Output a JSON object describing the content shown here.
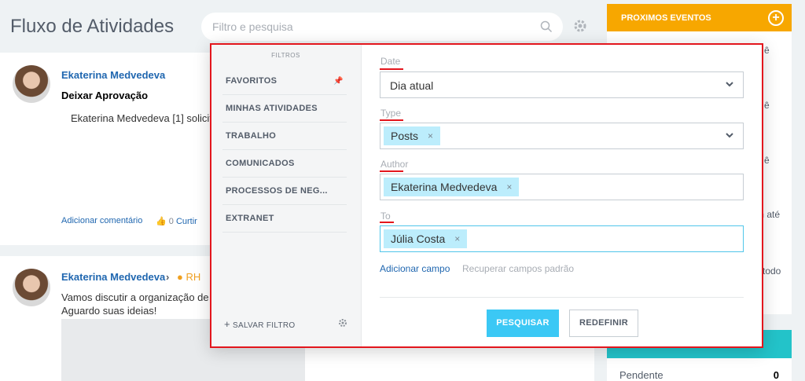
{
  "header": {
    "title": "Fluxo de Atividades",
    "search_placeholder": "Filtro e pesquisa"
  },
  "feed": {
    "post1": {
      "author": "Ekaterina Medvedeva",
      "title": "Deixar Aprovação",
      "text": "Ekaterina Medvedeva [1] solicit",
      "comment_link": "Adicionar comentário",
      "like_count": "0",
      "like_label": "Curtir"
    },
    "post2": {
      "author": "Ekaterina Medvedeva",
      "chevron": "›",
      "group": "RH",
      "text_line1": "Vamos discutir a organização de r",
      "text_line2": "Aguardo suas ideias!"
    }
  },
  "right_panel": {
    "events_title": "PROXIMOS EVENTOS",
    "fragments": [
      "ê",
      "ê",
      "ê",
      "m até",
      "todo"
    ],
    "pending_label": "Pendente",
    "pending_count": "0"
  },
  "filter_popup": {
    "filters_heading": "FILTROS",
    "presets": [
      {
        "label": "FAVORITOS"
      },
      {
        "label": "MINHAS ATIVIDADES"
      },
      {
        "label": "TRABALHO"
      },
      {
        "label": "COMUNICADOS"
      },
      {
        "label": "PROCESSOS DE NEG..."
      },
      {
        "label": "EXTRANET"
      }
    ],
    "save_filter_label": "SALVAR FILTRO",
    "fields": {
      "date": {
        "label": "Date",
        "value": "Dia atual"
      },
      "type": {
        "label": "Type",
        "tag": "Posts"
      },
      "author": {
        "label": "Author",
        "tag": "Ekaterina Medvedeva"
      },
      "to": {
        "label": "To",
        "tag": "Júlia Costa"
      }
    },
    "add_field_label": "Adicionar campo",
    "restore_fields_label": "Recuperar campos padrão",
    "search_button": "PESQUISAR",
    "reset_button": "REDEFINIR"
  },
  "colors": {
    "accent_orange": "#f7a700",
    "accent_teal": "#23c3c9",
    "button_blue": "#3bc8f5",
    "tag_blue": "#bcedfc",
    "highlight_red": "#e3161d",
    "link_blue": "#2067b0"
  }
}
